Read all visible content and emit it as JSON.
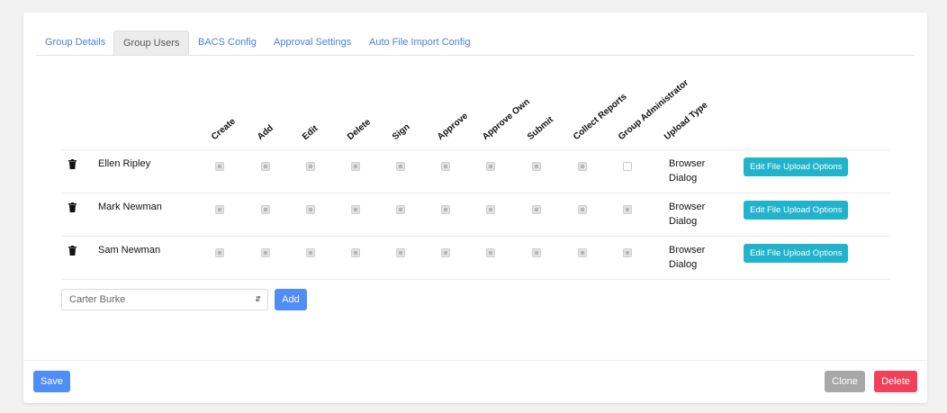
{
  "tabs": [
    {
      "label": "Group Details",
      "active": false
    },
    {
      "label": "Group Users",
      "active": true
    },
    {
      "label": "BACS Config",
      "active": false
    },
    {
      "label": "Approval Settings",
      "active": false
    },
    {
      "label": "Auto File Import Config",
      "active": false
    }
  ],
  "columns": [
    "Create",
    "Add",
    "Edit",
    "Delete",
    "Sign",
    "Approve",
    "Approve Own",
    "Submit",
    "Collect Reports",
    "Group Administrator",
    "Upload Type"
  ],
  "users": [
    {
      "name": "Ellen Ripley",
      "perms": [
        true,
        true,
        true,
        true,
        true,
        true,
        true,
        true,
        true,
        false
      ],
      "upload_type": "Browser Dialog",
      "edit_label": "Edit File Upload Options"
    },
    {
      "name": "Mark Newman",
      "perms": [
        true,
        true,
        true,
        true,
        true,
        true,
        true,
        true,
        true,
        true
      ],
      "upload_type": "Browser Dialog",
      "edit_label": "Edit File Upload Options"
    },
    {
      "name": "Sam Newman",
      "perms": [
        true,
        true,
        true,
        true,
        true,
        true,
        true,
        true,
        true,
        true
      ],
      "upload_type": "Browser Dialog",
      "edit_label": "Edit File Upload Options"
    }
  ],
  "add_user": {
    "selected": "Carter Burke",
    "add_label": "Add"
  },
  "footer": {
    "save_label": "Save",
    "clone_label": "Clone",
    "delete_label": "Delete"
  },
  "colors": {
    "primary": "#4f8ef7",
    "info": "#21b3cc",
    "secondary": "#a8a8a8",
    "danger": "#f0405a"
  }
}
